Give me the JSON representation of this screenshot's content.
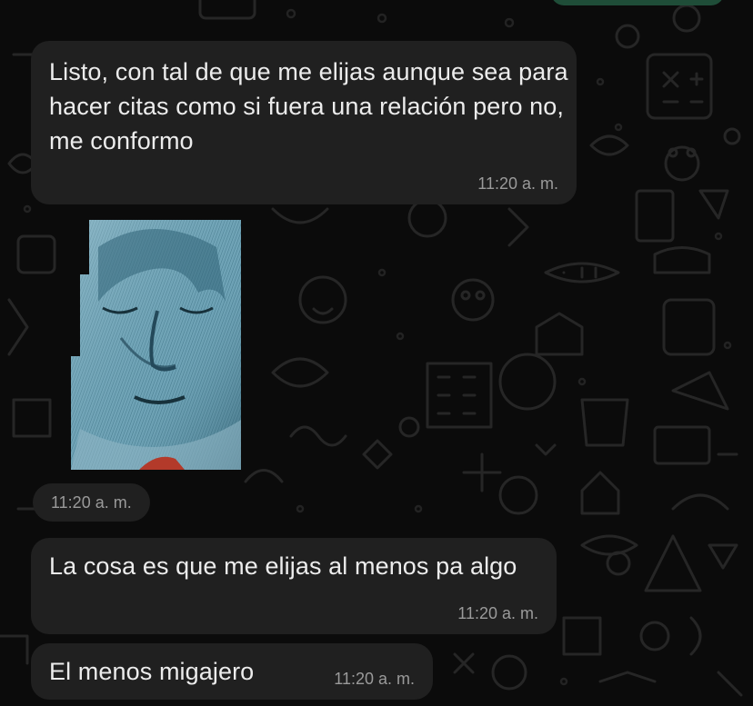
{
  "messages": [
    {
      "text": "Listo, con tal de que me elijas aunque sea para hacer citas como si fuera una relación pero no, me conformo",
      "time": "11:20 a. m."
    },
    {
      "sticker": "portrait-sticker",
      "time": "11:20 a. m."
    },
    {
      "text": "La cosa es que me elijas al menos pa algo",
      "time": "11:20 a. m."
    },
    {
      "text": "El menos migajero",
      "time": "11:20 a. m."
    }
  ],
  "colors": {
    "background": "#0b0b0b",
    "incoming_bubble": "#202020",
    "outgoing_bubble": "#1f4d38",
    "message_text": "#ececec",
    "timestamp": "#9a9a9a",
    "doodle": "#2a2a2a",
    "sticker_tint": "#5f93a8"
  }
}
